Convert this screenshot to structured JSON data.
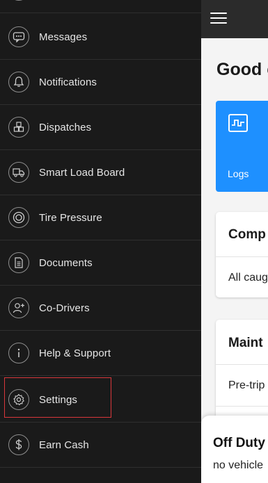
{
  "drawer": {
    "items": [
      {
        "label": "Messages",
        "icon": "chat-bubble-icon"
      },
      {
        "label": "Notifications",
        "icon": "bell-icon"
      },
      {
        "label": "Dispatches",
        "icon": "boxes-icon"
      },
      {
        "label": "Smart Load Board",
        "icon": "truck-icon"
      },
      {
        "label": "Tire Pressure",
        "icon": "tire-icon"
      },
      {
        "label": "Documents",
        "icon": "document-icon"
      },
      {
        "label": "Co-Drivers",
        "icon": "add-person-icon"
      },
      {
        "label": "Help & Support",
        "icon": "info-icon"
      },
      {
        "label": "Settings",
        "icon": "gear-icon"
      },
      {
        "label": "Earn Cash",
        "icon": "dollar-icon"
      }
    ],
    "highlighted_item": "Settings",
    "highlight_color": "#d9373b"
  },
  "main": {
    "greeting": "Good c",
    "logs_tile": {
      "label": "Logs",
      "color": "#1e90ff"
    },
    "compliance_card": {
      "title": "Comp",
      "row": "All caug"
    },
    "maintenance_card": {
      "title": "Maint",
      "row": "Pre-trip"
    },
    "status": {
      "title": "Off Duty",
      "subtitle": "no vehicle"
    }
  }
}
